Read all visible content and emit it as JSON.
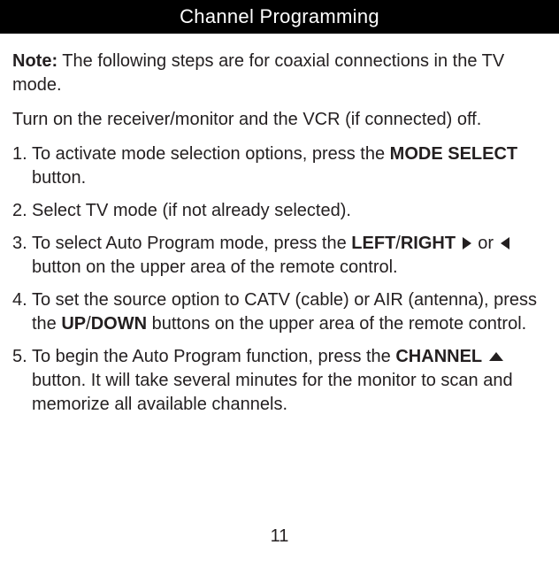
{
  "header": {
    "title": "Channel Programming"
  },
  "intro": {
    "note_label": "Note:",
    "note_text": " The following steps are for coaxial connections in the TV mode.",
    "para2": "Turn on the receiver/monitor and the VCR (if connected) off."
  },
  "steps": {
    "s1": {
      "a": "To activate mode selection options, press the ",
      "b": "MODE SELECT",
      "c": " button."
    },
    "s2": {
      "a": "Select TV mode (if not already selected)."
    },
    "s3": {
      "a": "To select Auto Program mode, press the ",
      "b": "LEFT",
      "slash": "/",
      "c": "RIGHT",
      "d": " ",
      "or": "or ",
      "e": " button on the upper area of the remote control."
    },
    "s4": {
      "a": "To set the source option to CATV (cable) or AIR (antenna), press the ",
      "b": "UP",
      "slash": "/",
      "c": "DOWN",
      "d": " buttons on the upper area of the remote control."
    },
    "s5": {
      "a": "To begin the Auto Program function, press the ",
      "b": "CHANNEL",
      "c": " ",
      "d": " button. It will take several minutes for the monitor to scan and memorize all available channels."
    }
  },
  "page_number": "11"
}
